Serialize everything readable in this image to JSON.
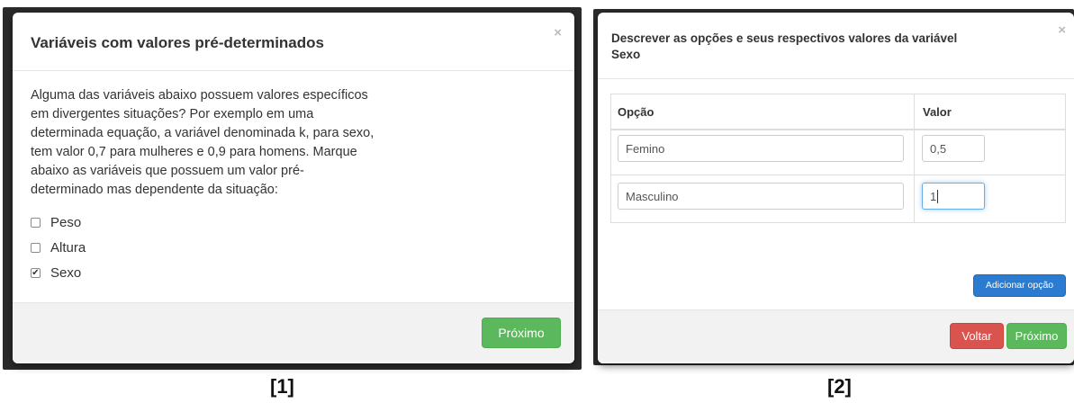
{
  "panel1": {
    "title": "Variáveis com valores pré-determinados",
    "close_glyph": "×",
    "body_lines": [
      "Alguma das variáveis abaixo possuem valores específicos",
      "em divergentes situações? Por exemplo em uma",
      "determinada equação, a variável denominada k, para sexo,",
      "tem valor 0,7 para mulheres e 0,9 para homens. Marque",
      "abaixo as variáveis que possuem um valor pré-",
      "determinado mas dependente da situação:"
    ],
    "options": [
      {
        "label": "Peso",
        "checked": false
      },
      {
        "label": "Altura",
        "checked": false
      },
      {
        "label": "Sexo",
        "checked": true
      }
    ],
    "next_label": "Próximo",
    "caption": "[1]"
  },
  "panel2": {
    "title_line1": "Descrever as opções e seus respectivos valores da variável",
    "title_line2": "Sexo",
    "close_glyph": "×",
    "col_option": "Opção",
    "col_value": "Valor",
    "rows": [
      {
        "option": "Femino",
        "value": "0,5"
      },
      {
        "option": "Masculino",
        "value": "1"
      }
    ],
    "add_label": "Adicionar opção",
    "back_label": "Voltar",
    "next_label": "Próximo",
    "caption": "[2]"
  },
  "colors": {
    "success": "#5cb85c",
    "danger": "#d9534f",
    "primary": "#2b7bd1",
    "focus": "#66afe9"
  }
}
